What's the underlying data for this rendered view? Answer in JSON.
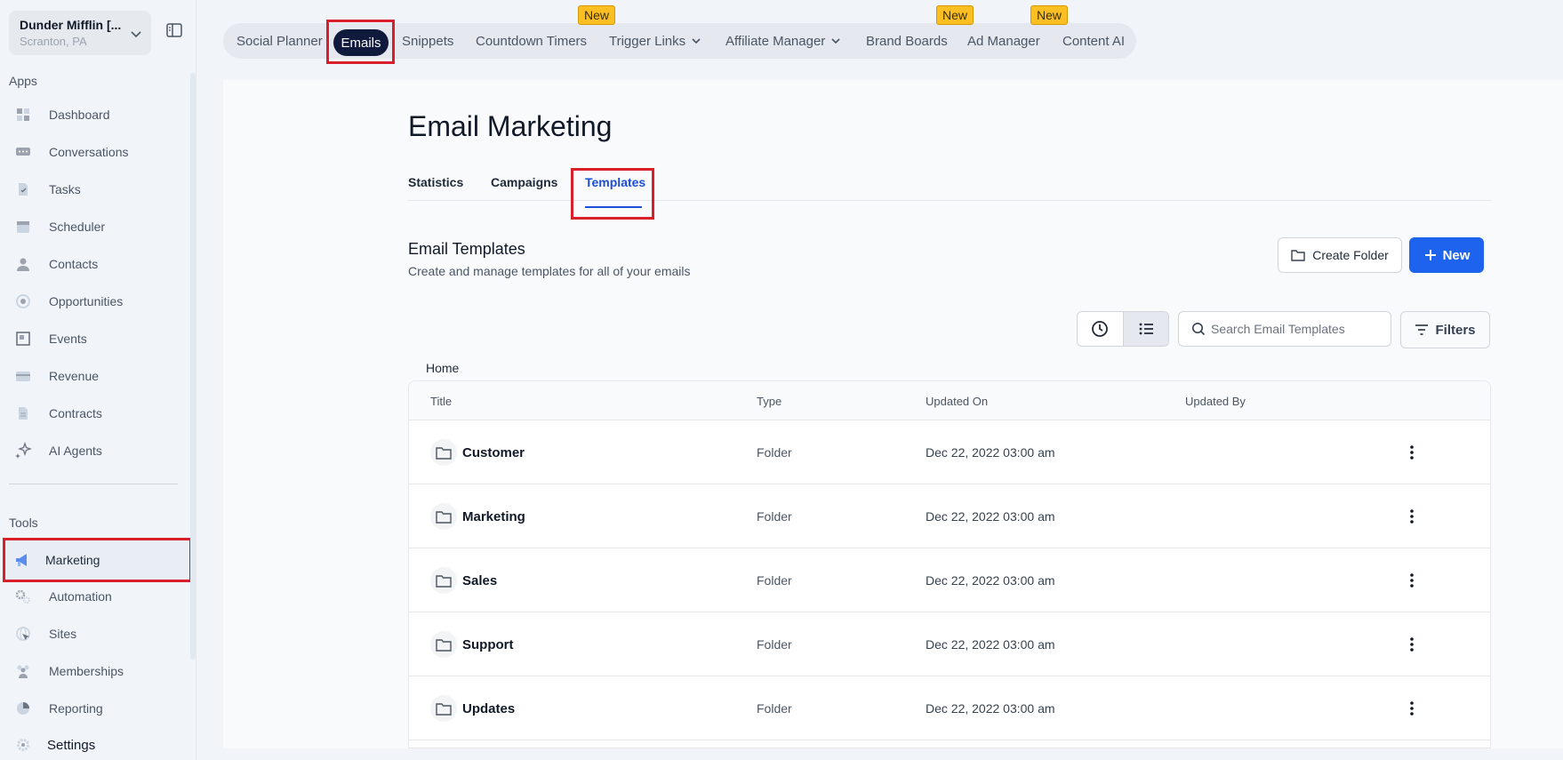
{
  "location": {
    "name": "Dunder Mifflin [...",
    "sub": "Scranton, PA"
  },
  "sidebar": {
    "apps_label": "Apps",
    "tools_label": "Tools",
    "apps": [
      {
        "label": "Dashboard",
        "icon": "dashboard-icon"
      },
      {
        "label": "Conversations",
        "icon": "chat-icon"
      },
      {
        "label": "Tasks",
        "icon": "tasks-icon"
      },
      {
        "label": "Scheduler",
        "icon": "calendar-icon"
      },
      {
        "label": "Contacts",
        "icon": "user-icon"
      },
      {
        "label": "Opportunities",
        "icon": "target-icon"
      },
      {
        "label": "Events",
        "icon": "events-icon"
      },
      {
        "label": "Revenue",
        "icon": "credit-card-icon"
      },
      {
        "label": "Contracts",
        "icon": "document-icon"
      },
      {
        "label": "AI Agents",
        "icon": "sparkle-icon"
      }
    ],
    "tools": [
      {
        "label": "Marketing",
        "icon": "megaphone-icon"
      },
      {
        "label": "Automation",
        "icon": "gears-icon"
      },
      {
        "label": "Sites",
        "icon": "globe-icon"
      },
      {
        "label": "Memberships",
        "icon": "people-icon"
      },
      {
        "label": "Reporting",
        "icon": "pie-chart-icon"
      }
    ],
    "settings": "Settings"
  },
  "topnav": {
    "items": [
      "Social Planner",
      "Emails",
      "Snippets",
      "Countdown Timers",
      "Trigger Links",
      "Affiliate Manager",
      "Brand Boards",
      "Ad Manager",
      "Content AI"
    ],
    "badge": "New"
  },
  "page": {
    "title": "Email Marketing",
    "tabs": [
      "Statistics",
      "Campaigns",
      "Templates"
    ],
    "section_title": "Email Templates",
    "section_sub": "Create and manage templates for all of your emails",
    "create_folder": "Create Folder",
    "new_label": "New",
    "search_placeholder": "Search Email Templates",
    "filters": "Filters",
    "breadcrumb": "Home"
  },
  "table": {
    "headers": [
      "Title",
      "Type",
      "Updated On",
      "Updated By"
    ],
    "rows": [
      {
        "title": "Customer",
        "type": "Folder",
        "updated_on": "Dec 22, 2022 03:00 am",
        "updated_by": ""
      },
      {
        "title": "Marketing",
        "type": "Folder",
        "updated_on": "Dec 22, 2022 03:00 am",
        "updated_by": ""
      },
      {
        "title": "Sales",
        "type": "Folder",
        "updated_on": "Dec 22, 2022 03:00 am",
        "updated_by": ""
      },
      {
        "title": "Support",
        "type": "Folder",
        "updated_on": "Dec 22, 2022 03:00 am",
        "updated_by": ""
      },
      {
        "title": "Updates",
        "type": "Folder",
        "updated_on": "Dec 22, 2022 03:00 am",
        "updated_by": ""
      }
    ]
  },
  "colors": {
    "accent": "#1d63ed",
    "highlight": "#d91f2b",
    "badge": "#fbbf24",
    "active_pill": "#0f1a3c"
  }
}
